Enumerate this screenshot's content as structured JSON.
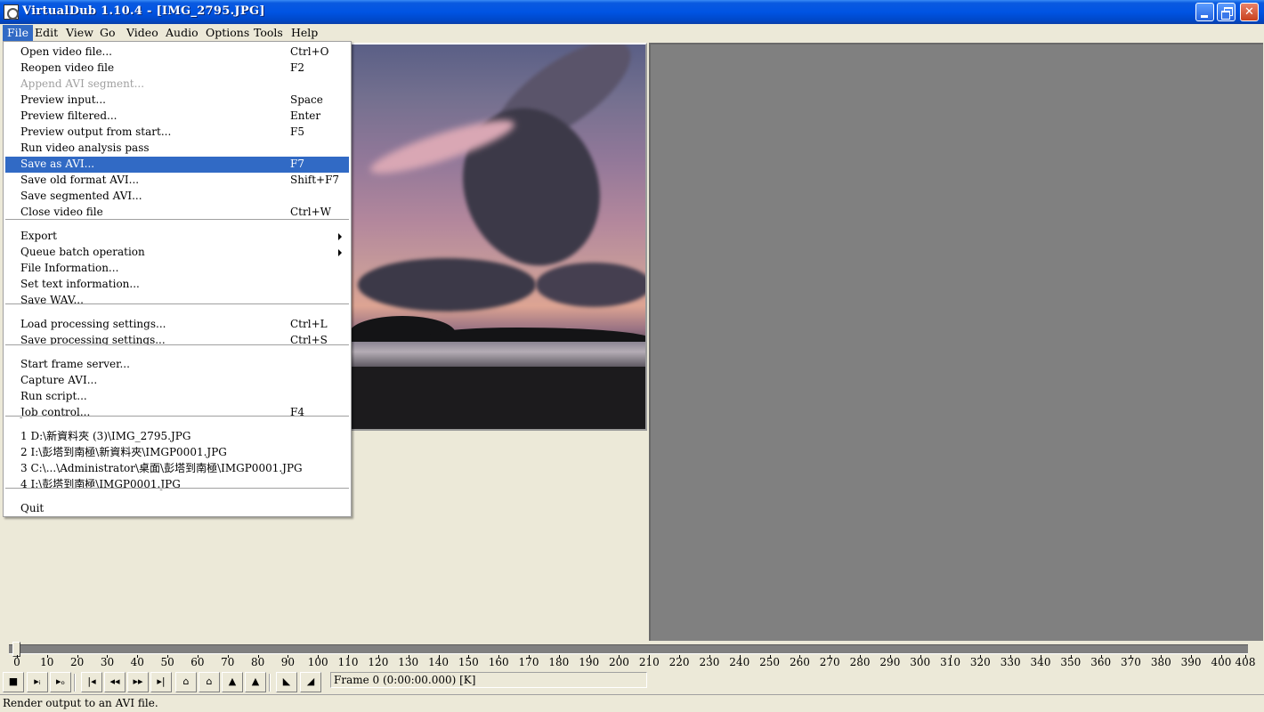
{
  "window": {
    "title": "VirtualDub 1.10.4 - [IMG_2795.JPG]"
  },
  "menubar": [
    "File",
    "Edit",
    "View",
    "Go",
    "Video",
    "Audio",
    "Options",
    "Tools",
    "Help"
  ],
  "file_menu": {
    "items": [
      {
        "label": "Open video file...",
        "shortcut": "Ctrl+O"
      },
      {
        "label": "Reopen video file",
        "shortcut": "F2"
      },
      {
        "label": "Append AVI segment...",
        "shortcut": "",
        "disabled": true
      },
      {
        "label": "Preview input...",
        "shortcut": "Space"
      },
      {
        "label": "Preview filtered...",
        "shortcut": "Enter"
      },
      {
        "label": "Preview output from start...",
        "shortcut": "F5"
      },
      {
        "label": "Run video analysis pass",
        "shortcut": ""
      },
      {
        "label": "Save as AVI...",
        "shortcut": "F7",
        "highlighted": true
      },
      {
        "label": "Save old format AVI...",
        "shortcut": "Shift+F7"
      },
      {
        "label": "Save segmented AVI...",
        "shortcut": ""
      },
      {
        "label": "Close video file",
        "shortcut": "Ctrl+W"
      },
      {
        "label": "Export",
        "shortcut": "",
        "submenu": true
      },
      {
        "label": "Queue batch operation",
        "shortcut": "",
        "submenu": true
      },
      {
        "label": "File Information...",
        "shortcut": ""
      },
      {
        "label": "Set text information...",
        "shortcut": ""
      },
      {
        "label": "Save WAV...",
        "shortcut": ""
      },
      {
        "label": "Load processing settings...",
        "shortcut": "Ctrl+L"
      },
      {
        "label": "Save processing settings...",
        "shortcut": "Ctrl+S"
      },
      {
        "label": "Start frame server...",
        "shortcut": ""
      },
      {
        "label": "Capture AVI...",
        "shortcut": ""
      },
      {
        "label": "Run script...",
        "shortcut": ""
      },
      {
        "label": "Job control...",
        "shortcut": "F4"
      },
      {
        "label": "1 D:\\新資料夾 (3)\\IMG_2795.JPG",
        "shortcut": ""
      },
      {
        "label": "2 I:\\彭塔到南極\\新資料夾\\IMGP0001.JPG",
        "shortcut": ""
      },
      {
        "label": "3 C:\\...\\Administrator\\桌面\\彭塔到南極\\IMGP0001.JPG",
        "shortcut": ""
      },
      {
        "label": "4 I:\\彭塔到南極\\IMGP0001.JPG",
        "shortcut": ""
      },
      {
        "label": "Quit",
        "shortcut": ""
      }
    ]
  },
  "timeline": {
    "ticks": [
      "0",
      "10",
      "20",
      "30",
      "40",
      "50",
      "60",
      "70",
      "80",
      "90",
      "100",
      "110",
      "120",
      "130",
      "140",
      "150",
      "160",
      "170",
      "180",
      "190",
      "200",
      "210",
      "220",
      "230",
      "240",
      "250",
      "260",
      "270",
      "280",
      "290",
      "300",
      "310",
      "320",
      "330",
      "340",
      "350",
      "360",
      "370",
      "380",
      "390",
      "400",
      "408"
    ],
    "position": 0
  },
  "toolbar": {
    "buttons": [
      {
        "name": "stop-icon",
        "glyph": "■"
      },
      {
        "name": "play-input-icon",
        "glyph": "▸ᵢ"
      },
      {
        "name": "play-output-icon",
        "glyph": "▸ₒ"
      },
      {
        "name": "go-start-icon",
        "glyph": "|◂"
      },
      {
        "name": "prev-frame-icon",
        "glyph": "◂◂"
      },
      {
        "name": "next-frame-icon",
        "glyph": "▸▸"
      },
      {
        "name": "go-end-icon",
        "glyph": "▸|"
      },
      {
        "name": "prev-keyframe-icon",
        "glyph": "⌂"
      },
      {
        "name": "next-keyframe-icon",
        "glyph": "⌂"
      },
      {
        "name": "prev-scene-icon",
        "glyph": "▲"
      },
      {
        "name": "next-scene-icon",
        "glyph": "▲"
      },
      {
        "name": "mark-in-icon",
        "glyph": "◣"
      },
      {
        "name": "mark-out-icon",
        "glyph": "◢"
      }
    ],
    "frame_text": "Frame 0 (0:00:00.000) [K]"
  },
  "status_text": "Render output to an AVI file."
}
